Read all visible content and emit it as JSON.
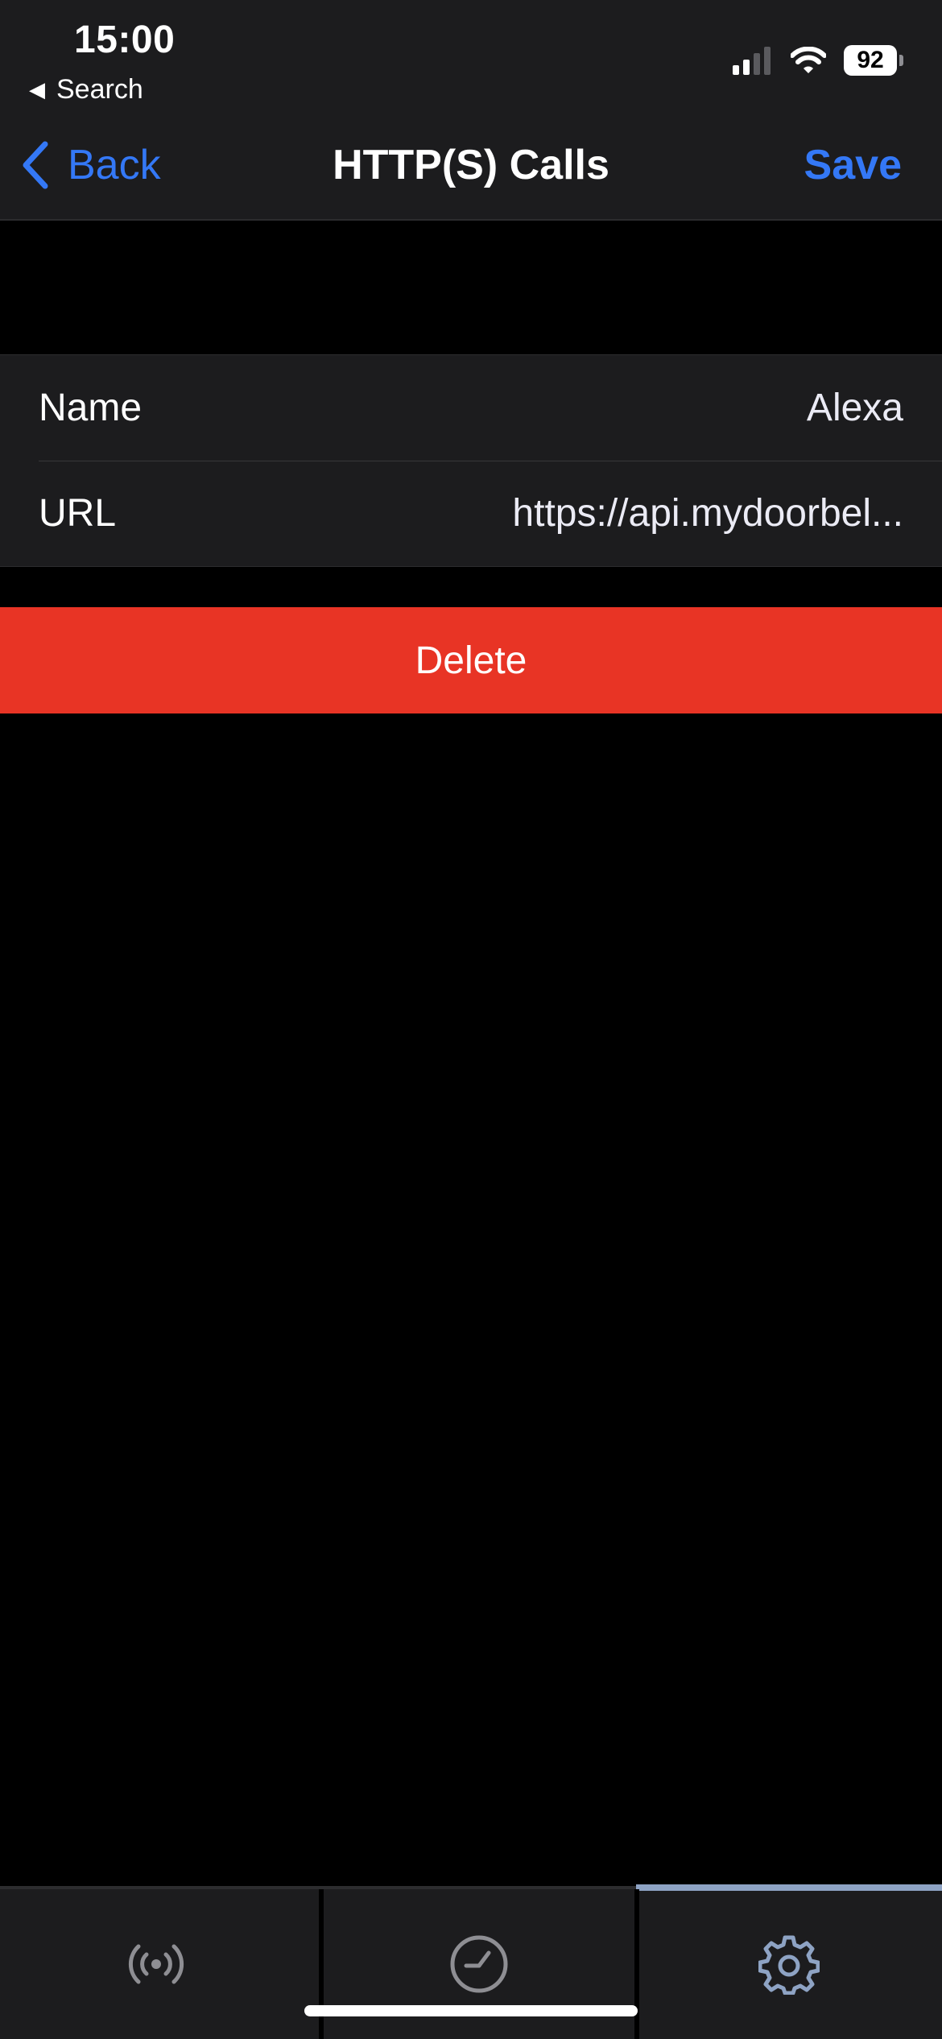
{
  "status_bar": {
    "time": "15:00",
    "back_app": "Search",
    "battery": "92",
    "icons": [
      "cellular-signal-icon",
      "wifi-icon",
      "battery-icon"
    ]
  },
  "nav": {
    "back_label": "Back",
    "title": "HTTP(S) Calls",
    "save_label": "Save"
  },
  "form": {
    "rows": [
      {
        "label": "Name",
        "value": "Alexa"
      },
      {
        "label": "URL",
        "value": "https://api.mydoorbel..."
      }
    ]
  },
  "delete_label": "Delete",
  "tabbar": {
    "tabs": [
      {
        "icon": "broadcast-icon",
        "selected": false
      },
      {
        "icon": "clock-icon",
        "selected": false
      },
      {
        "icon": "gear-icon",
        "selected": true
      }
    ]
  },
  "colors": {
    "accent": "#3478f6",
    "destructive": "#e83425",
    "header_bg": "#1c1c1e",
    "page_bg": "#000000",
    "tab_indicator": "#8ea3c4"
  }
}
